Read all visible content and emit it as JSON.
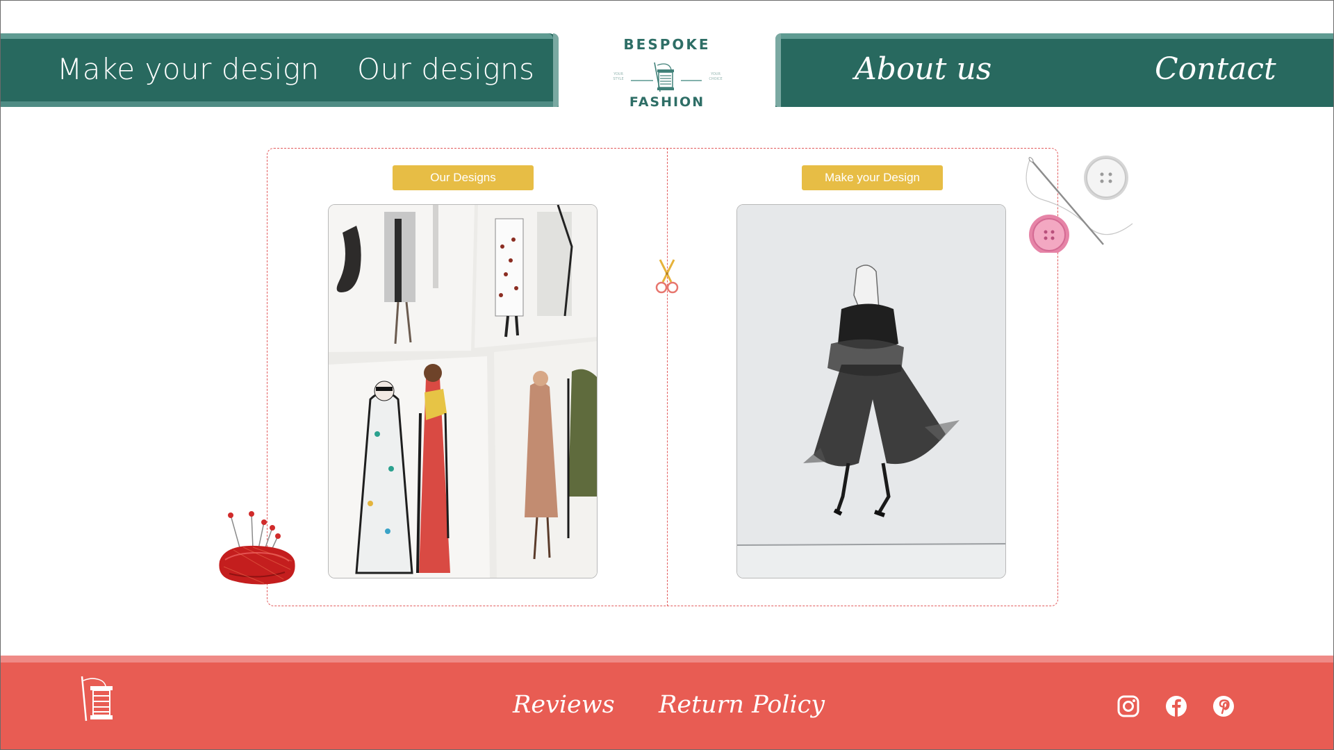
{
  "nav": {
    "make_your_design": "Make your design",
    "our_designs": "Our designs",
    "about_us": "About us",
    "contact": "Contact"
  },
  "logo": {
    "top_text": "BESPOKE",
    "bottom_text": "FASHION",
    "left_small": "YOUR STYLE",
    "right_small": "YOUR CHOICE"
  },
  "main": {
    "our_designs_button": "Our Designs",
    "make_design_button": "Make your Design"
  },
  "footer": {
    "reviews": "Reviews",
    "return_policy": "Return Policy",
    "social": [
      "instagram-icon",
      "facebook-icon",
      "pinterest-icon"
    ]
  },
  "colors": {
    "nav_teal": "#28695f",
    "accent_yellow": "#e7bd45",
    "dashed_red": "#e25b5c",
    "footer_red": "#e85c53"
  }
}
